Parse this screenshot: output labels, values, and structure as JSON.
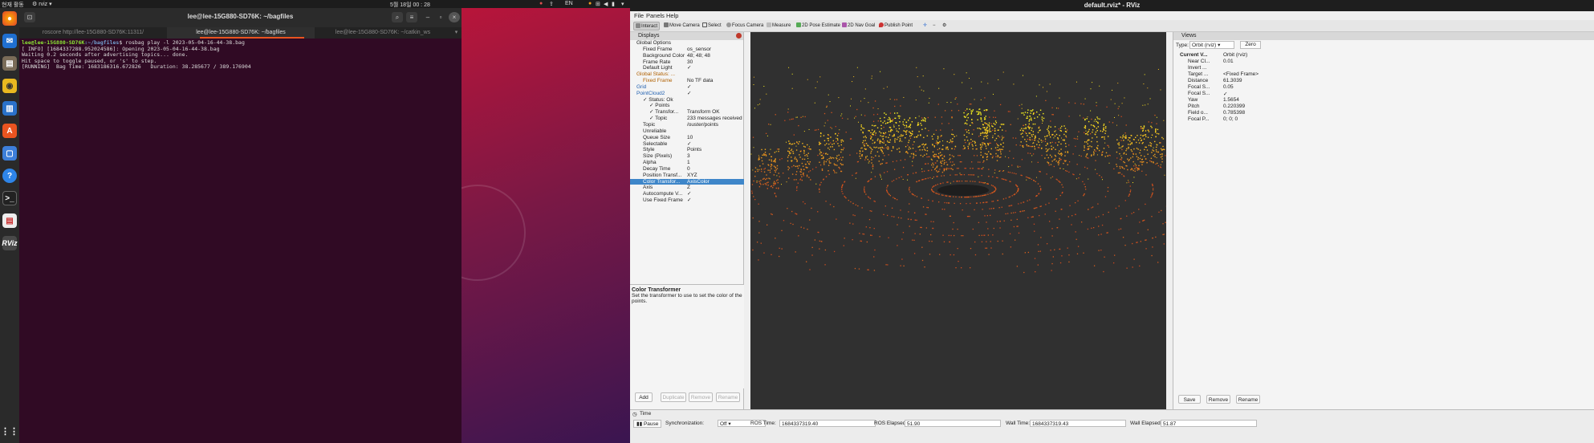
{
  "topbar": {
    "activities": "현재 활동",
    "app_name": "rviz",
    "clock": "5월 18일 00 : 28",
    "lang": "EN"
  },
  "terminal": {
    "title": "lee@lee-15G880-SD76K: ~/bagfiles",
    "tabs": [
      "roscore http://lee-15G880-SD76K:11311/",
      "lee@lee-15G880-SD76K: ~/bagfiles",
      "lee@lee-15G880-SD76K: ~/catkin_ws"
    ],
    "prompt_user": "lee@lee-15G880-SD76K",
    "prompt_path": ":~/bagfiles",
    "command": "$ rosbag play -l 2023-05-04-16-44-38.bag",
    "lines": [
      "[ INFO] [1684337288.952024586]: Opening 2023-05-04-16-44-38.bag",
      "",
      "Waiting 0.2 seconds after advertising topics... done.",
      "",
      "Hit space to toggle paused, or 's' to step.",
      "[RUNNING]  Bag Time: 1683186316.672826   Duration: 38.285677 / 389.176904"
    ]
  },
  "rviz": {
    "title": "default.rviz* - RViz",
    "menu": [
      "File",
      "Panels",
      "Help"
    ],
    "tools": [
      "Interact",
      "Move Camera",
      "Select",
      "Focus Camera",
      "Measure",
      "2D Pose Estimate",
      "2D Nav Goal",
      "Publish Point"
    ],
    "displays": {
      "header": "Displays",
      "rows": [
        {
          "k": "Global Options",
          "v": "",
          "indent": 1,
          "type": "group"
        },
        {
          "k": "Fixed Frame",
          "v": "os_sensor",
          "indent": 2
        },
        {
          "k": "Background Color",
          "v": "48; 48; 48",
          "indent": 2
        },
        {
          "k": "Frame Rate",
          "v": "30",
          "indent": 2
        },
        {
          "k": "Default Light",
          "v": "✓",
          "indent": 2
        },
        {
          "k": "Global Status: ...",
          "v": "",
          "indent": 1,
          "type": "warn"
        },
        {
          "k": "Fixed Frame",
          "v": "No TF data",
          "indent": 2,
          "type": "warn"
        },
        {
          "k": "Grid",
          "v": "✓",
          "indent": 1,
          "type": "blue"
        },
        {
          "k": "PointCloud2",
          "v": "✓",
          "indent": 1,
          "type": "blue"
        },
        {
          "k": "✓ Status: Ok",
          "v": "",
          "indent": 2
        },
        {
          "k": "✓ Points",
          "v": "",
          "indent": 3
        },
        {
          "k": "✓ Transfor...",
          "v": "Transform OK",
          "indent": 3
        },
        {
          "k": "✓ Topic",
          "v": "233 messages received",
          "indent": 3
        },
        {
          "k": "Topic",
          "v": "/ouster/points",
          "indent": 2
        },
        {
          "k": "Unreliable",
          "v": "",
          "indent": 2
        },
        {
          "k": "Queue Size",
          "v": "10",
          "indent": 2
        },
        {
          "k": "Selectable",
          "v": "✓",
          "indent": 2
        },
        {
          "k": "Style",
          "v": "Points",
          "indent": 2
        },
        {
          "k": "Size (Pixels)",
          "v": "3",
          "indent": 2
        },
        {
          "k": "Alpha",
          "v": "1",
          "indent": 2
        },
        {
          "k": "Decay Time",
          "v": "0",
          "indent": 2
        },
        {
          "k": "Position Transf...",
          "v": "XYZ",
          "indent": 2
        },
        {
          "k": "Color Transfor...",
          "v": "AxisColor",
          "indent": 2,
          "type": "sel"
        },
        {
          "k": "Axis",
          "v": "Z",
          "indent": 2
        },
        {
          "k": "Autocompute V...",
          "v": "✓",
          "indent": 2
        },
        {
          "k": "Use Fixed Frame",
          "v": "✓",
          "indent": 2
        }
      ],
      "desc_title": "Color Transformer",
      "desc_text": "Set the transformer to use to set the color of the points.",
      "buttons": [
        "Add",
        "Duplicate",
        "Remove",
        "Rename"
      ]
    },
    "views": {
      "header": "Views",
      "type_label": "Type:",
      "type_value": "Orbit (rviz)",
      "zero": "Zero",
      "rows": [
        {
          "k": "Current V...",
          "v": "Orbit (rviz)"
        },
        {
          "k": "Near Cl...",
          "v": "0.01"
        },
        {
          "k": "Invert ...",
          "v": ""
        },
        {
          "k": "Target ...",
          "v": "<Fixed Frame>"
        },
        {
          "k": "Distance",
          "v": "61.3039"
        },
        {
          "k": "Focal S...",
          "v": "0.05"
        },
        {
          "k": "Focal S...",
          "v": "✓"
        },
        {
          "k": "Yaw",
          "v": "1.5654"
        },
        {
          "k": "Pitch",
          "v": "0.220399"
        },
        {
          "k": "Field o...",
          "v": "0.785398"
        },
        {
          "k": "Focal P...",
          "v": "0; 0; 0"
        }
      ],
      "buttons": [
        "Save",
        "Remove",
        "Rename"
      ]
    },
    "time": {
      "header": "Time",
      "pause": "Pause",
      "sync_label": "Synchronization:",
      "sync_value": "Off",
      "ros_time_label": "ROS Time:",
      "ros_time": "1684337319.40",
      "ros_elapsed_label": "ROS Elapsed:",
      "ros_elapsed": "51.90",
      "wall_time_label": "Wall Time:",
      "wall_time": "1684337319.43",
      "wall_elapsed_label": "Wall Elapsed:",
      "wall_elapsed": "51.87"
    }
  },
  "colors": {
    "terminal_bg": "#300a24",
    "viewport_bg": "#303030",
    "selection": "#3e86c9",
    "ubuntu_orange": "#e95420"
  }
}
